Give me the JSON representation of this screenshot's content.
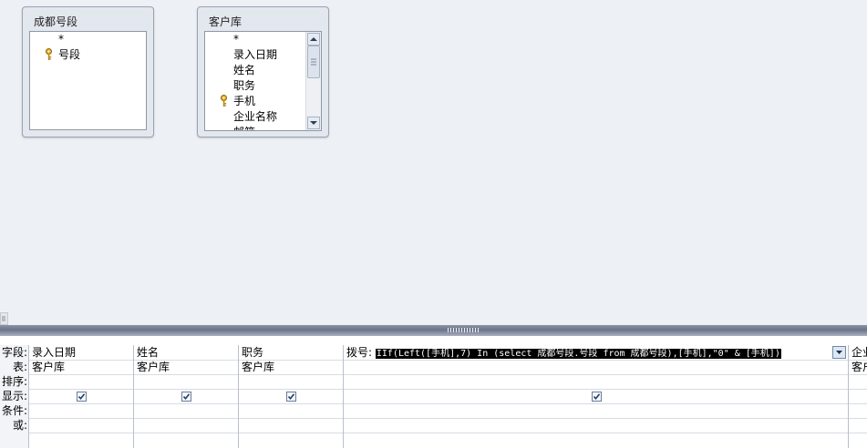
{
  "tables": [
    {
      "title": "成都号段",
      "fields": [
        "*",
        "号段"
      ],
      "key_field_index": 1
    },
    {
      "title": "客户库",
      "fields": [
        "*",
        "录入日期",
        "姓名",
        "职务",
        "手机",
        "企业名称",
        "邮箱"
      ],
      "key_field_index": 4
    }
  ],
  "row_labels": [
    "字段:",
    "表:",
    "排序:",
    "显示:",
    "条件:",
    "或:"
  ],
  "columns": [
    {
      "field": "录入日期",
      "table": "客户库",
      "show": true
    },
    {
      "field": "姓名",
      "table": "客户库",
      "show": true
    },
    {
      "field": "职务",
      "table": "客户库",
      "show": true
    },
    {
      "field_prefix": "拨号:",
      "field_expr": "IIf(Left([手机],7) In (select 成都号段.号段 from 成都号段),[手机],\"0\" & [手机])",
      "table": "",
      "show": true
    },
    {
      "field": "企业",
      "table": "客户",
      "show": false
    }
  ],
  "icons": {
    "key": "key-icon",
    "checkbox": "checkmark-icon",
    "dropdown": "chevron-down-icon"
  }
}
